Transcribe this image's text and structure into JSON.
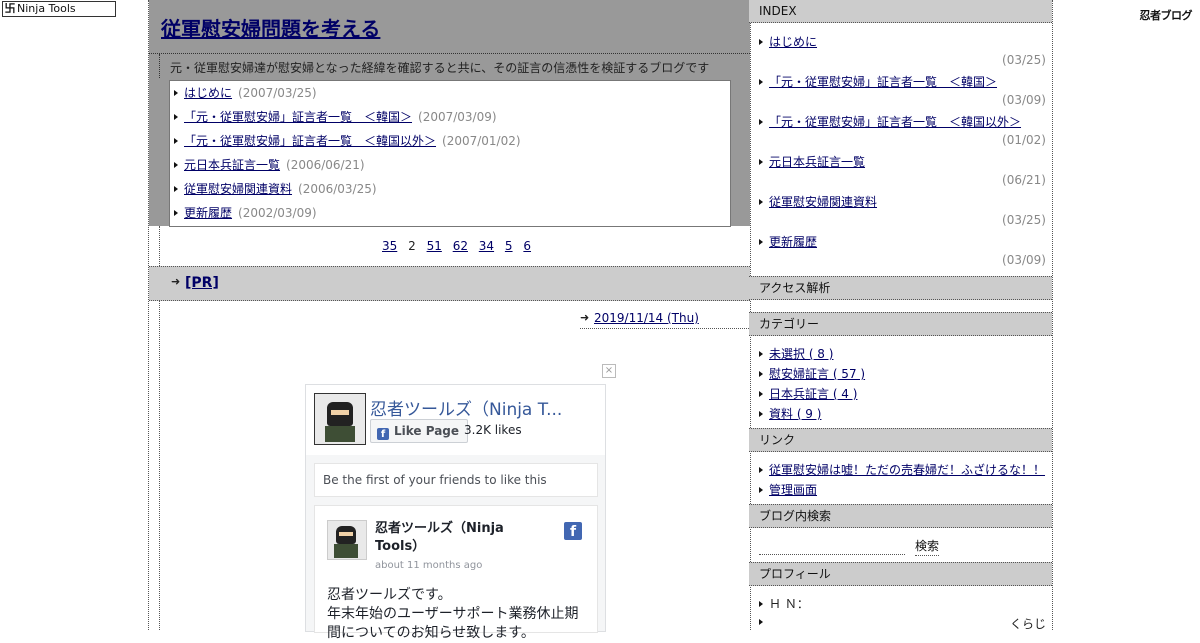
{
  "top_badge": {
    "label": "Ninja Tools"
  },
  "top_logo": {
    "label": "忍者ブログ"
  },
  "header": {
    "title": "従軍慰安婦問題を考える",
    "description": "元・従軍慰安婦達が慰安婦となった経緯を確認すると共に、その証言の信憑性を検証するブログです"
  },
  "recent_entries": [
    {
      "title": "はじめに",
      "date": "(2007/03/25)"
    },
    {
      "title": "「元・従軍慰安婦」証言者一覧　＜韓国＞",
      "date": "(2007/03/09)"
    },
    {
      "title": "「元・従軍慰安婦」証言者一覧　＜韓国以外＞",
      "date": "(2007/01/02)"
    },
    {
      "title": "元日本兵証言一覧",
      "date": "(2006/06/21)"
    },
    {
      "title": "従軍慰安婦関連資料",
      "date": "(2006/03/25)"
    },
    {
      "title": "更新履歴",
      "date": "(2002/03/09)"
    }
  ],
  "pager": [
    "35",
    "2",
    "51",
    "62",
    "34",
    "5",
    "6"
  ],
  "pr": {
    "label": "[PR]"
  },
  "post": {
    "date": "2019/11/14 (Thu)"
  },
  "fb_widget": {
    "close": "×",
    "page_name": "忍者ツールズ（Ninja T...",
    "like_button": "Like Page",
    "likes": "3.2K likes",
    "friends_text": "Be the first of your friends to like this",
    "post_name": "忍者ツールズ（Ninja Tools）",
    "post_time": "about 11 months ago",
    "post_text_1": "忍者ツールズです。",
    "post_text_2": "年末年始のユーザーサポート業務休止期",
    "post_text_3": "間についてのお知らせ致します。",
    "logo": "f"
  },
  "sidebar": {
    "index_heading": "INDEX",
    "index_items": [
      {
        "title": "はじめに",
        "date": "(03/25)"
      },
      {
        "title": "「元・従軍慰安婦」証言者一覧　＜韓国＞",
        "date": "(03/09)"
      },
      {
        "title": "「元・従軍慰安婦」証言者一覧　＜韓国以外＞",
        "date": "(01/02)"
      },
      {
        "title": "元日本兵証言一覧",
        "date": "(06/21)"
      },
      {
        "title": "従軍慰安婦関連資料",
        "date": "(03/25)"
      },
      {
        "title": "更新履歴",
        "date": "(03/09)"
      }
    ],
    "access_heading": "アクセス解析",
    "category_heading": "カテゴリー",
    "categories": [
      "未選択 ( 8 )",
      "慰安婦証言 ( 57 )",
      "日本兵証言 ( 4 )",
      "資料 ( 9 )"
    ],
    "links_heading": "リンク",
    "links": [
      "従軍慰安婦は嘘！ただの売春婦だ！ふざけるな！！",
      "管理画面"
    ],
    "search_heading": "ブログ内検索",
    "search_button": "検索",
    "profile_heading": "プロフィール",
    "profile_hn_label": "Ｈ Ｎ：",
    "profile_hn_value": "くらじ"
  },
  "colors": {
    "header_bg": "#999999",
    "bar_bg": "#cccccc",
    "link": "#000066",
    "fb_blue": "#4267b2"
  },
  "icons": [
    "ninja-tools-icon",
    "bullet-arrow-icon",
    "close-icon",
    "facebook-icon"
  ]
}
